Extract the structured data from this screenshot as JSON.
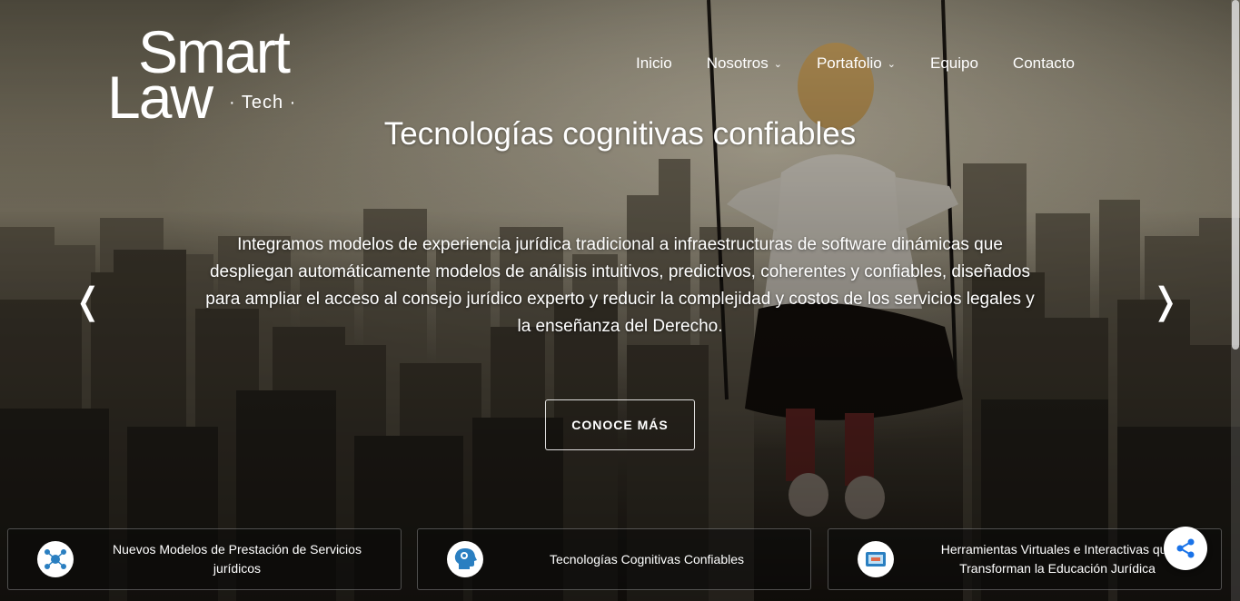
{
  "brand": {
    "smart": "Smart",
    "law": "Law",
    "tech": "· Tech ·"
  },
  "nav": {
    "items": [
      {
        "label": "Inicio",
        "dropdown": false
      },
      {
        "label": "Nosotros",
        "dropdown": true
      },
      {
        "label": "Portafolio",
        "dropdown": true
      },
      {
        "label": "Equipo",
        "dropdown": false
      },
      {
        "label": "Contacto",
        "dropdown": false
      }
    ]
  },
  "hero": {
    "title": "Tecnologías cognitivas confiables",
    "description": "Integramos modelos de experiencia jurídica tradicional a infraestructuras de software dinámicas que despliegan automáticamente modelos de análisis intuitivos, predictivos, coherentes y confiables, diseñados para ampliar el acceso al consejo jurídico experto y reducir la complejidad y costos de los servicios legales y la enseñanza del Derecho.",
    "cta": "CONOCE MÁS",
    "prev_arrow": "❬",
    "next_arrow": "❭"
  },
  "features": [
    {
      "label": "Nuevos Modelos de Prestación de Servicios jurídicos",
      "icon": "network-nodes-icon"
    },
    {
      "label": "Tecnologías Cognitivas Confiables",
      "icon": "brain-head-icon"
    },
    {
      "label": "Herramientas Virtuales e Interactivas que Transforman la Educación Jurídica",
      "icon": "tablet-screen-icon"
    }
  ],
  "colors": {
    "icon_blue": "#2a7fc1",
    "share_blue": "#1a73e8"
  }
}
